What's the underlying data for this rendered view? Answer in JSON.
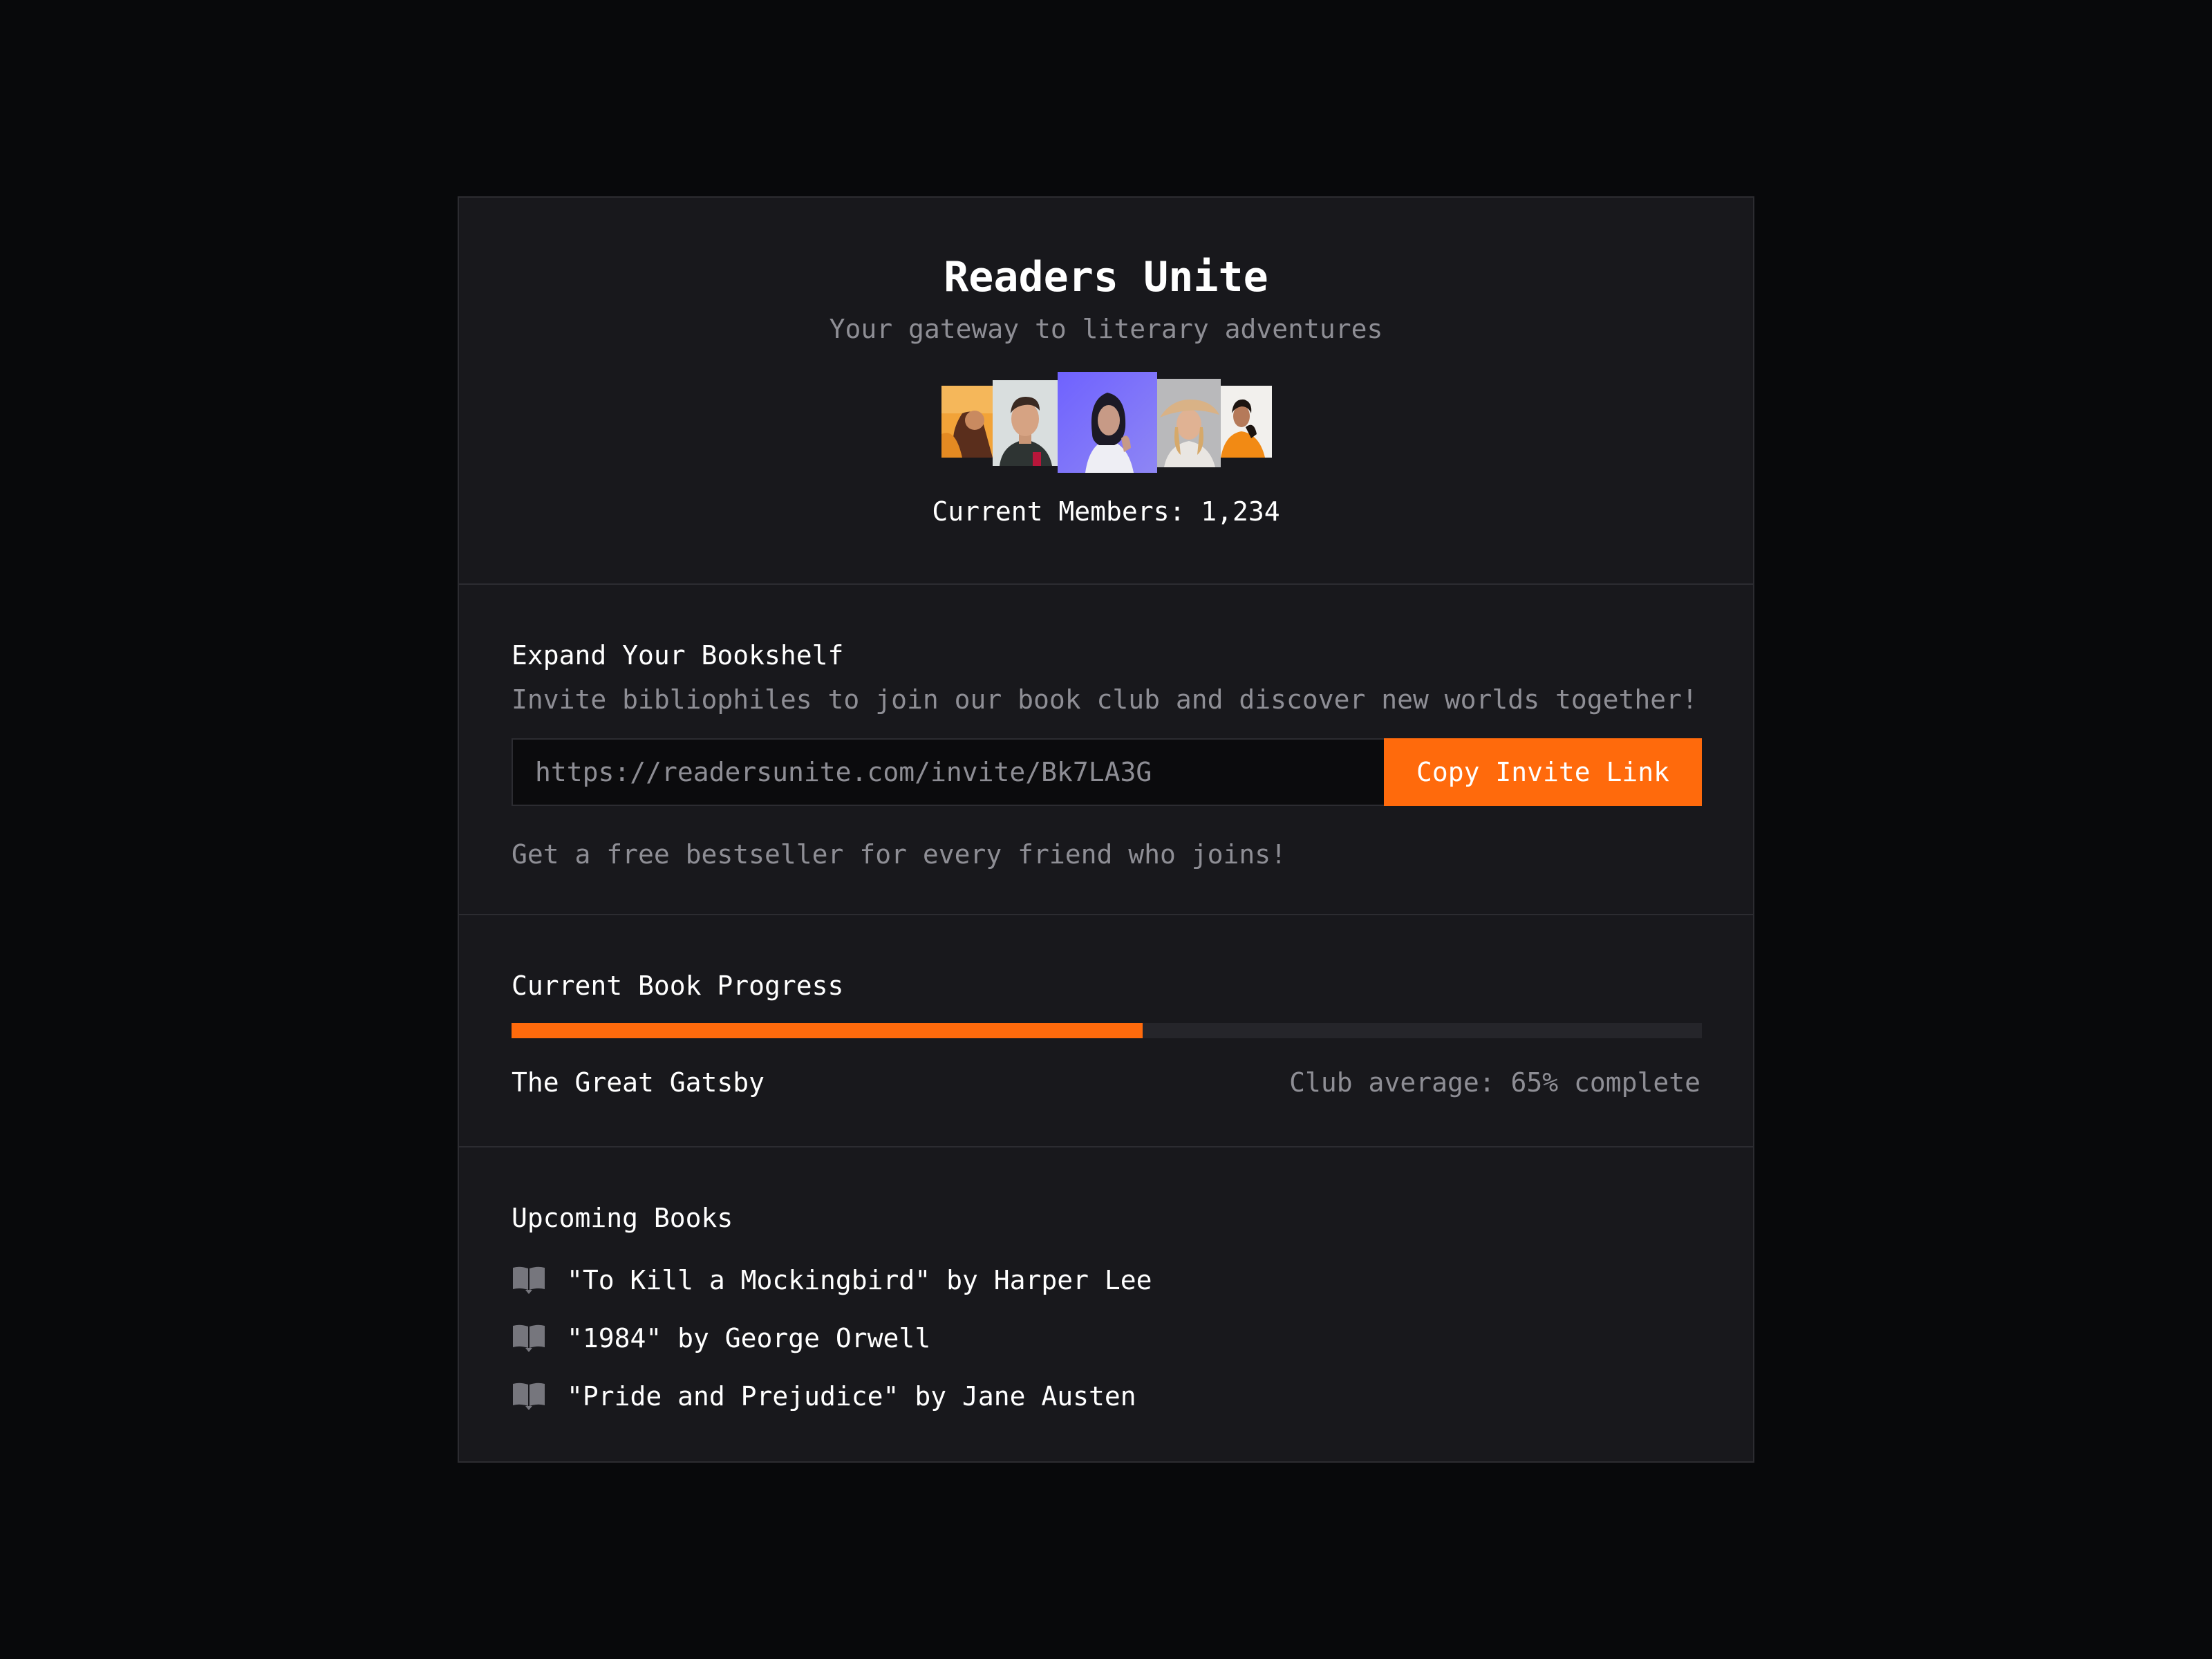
{
  "header": {
    "title": "Readers Unite",
    "subtitle": "Your gateway to literary adventures",
    "members_label": "Current Members: 1,234",
    "avatars": [
      "member-avatar-1",
      "member-avatar-2",
      "member-avatar-3",
      "member-avatar-4",
      "member-avatar-5"
    ]
  },
  "invite": {
    "heading": "Expand Your Bookshelf",
    "description": "Invite bibliophiles to join our book club and discover new worlds together!",
    "link_value": "https://readersunite.com/invite/Bk7LA3G",
    "button_label": "Copy Invite Link",
    "reward_text": "Get a free bestseller for every friend who joins!"
  },
  "progress": {
    "heading": "Current Book Progress",
    "book_title": "The Great Gatsby",
    "club_average_text": "Club average: 65% complete",
    "bar_fraction": 0.53
  },
  "upcoming": {
    "heading": "Upcoming Books",
    "items": [
      {
        "text": "\"To Kill a Mockingbird\" by Harper Lee",
        "icon": "book-icon"
      },
      {
        "text": "\"1984\" by George Orwell",
        "icon": "book-icon"
      },
      {
        "text": "\"Pride and Prejudice\" by Jane Austen",
        "icon": "book-icon"
      }
    ]
  },
  "colors": {
    "background": "#08090b",
    "card": "#18181c",
    "accent": "#ff6a0c",
    "muted_text": "#8e8e95",
    "border": "#2c2c31"
  }
}
